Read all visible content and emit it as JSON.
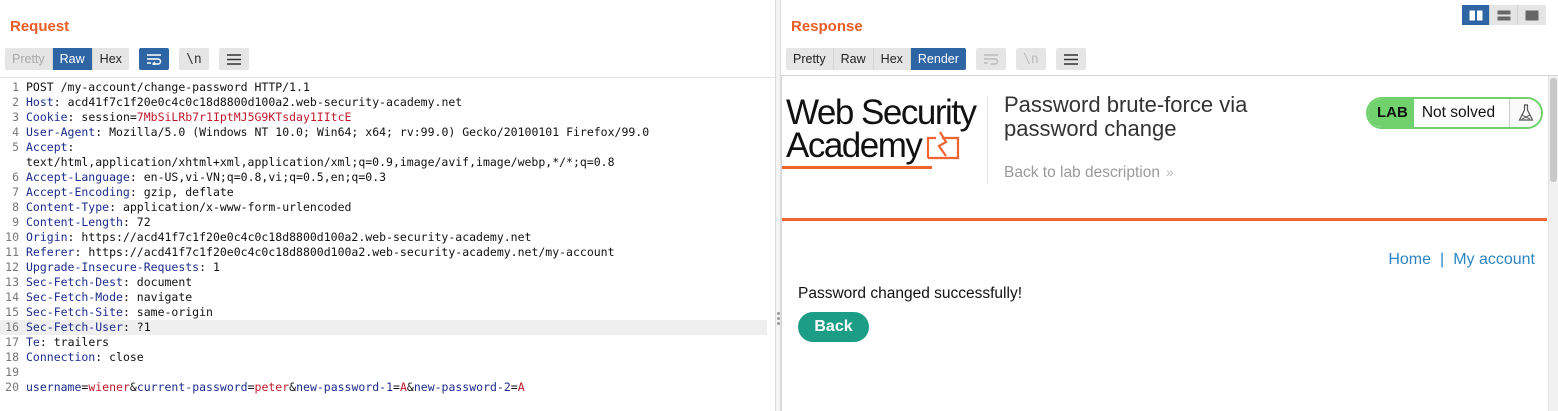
{
  "request": {
    "title": "Request",
    "view_tabs": [
      "Pretty",
      "Raw",
      "Hex"
    ],
    "active_tab": "Raw",
    "newline_label": "\\n",
    "lines": [
      {
        "num": "1",
        "raw": "POST /my-account/change-password HTTP/1.1"
      },
      {
        "num": "2",
        "key": "Host",
        "value": " acd41f7c1f20e0c4c0c18d8800d100a2.web-security-academy.net"
      },
      {
        "num": "3",
        "key": "Cookie",
        "value": " session=",
        "value_red": "7MbSiLRb7r1IptMJ5G9KTsday1IItcE"
      },
      {
        "num": "4",
        "key": "User-Agent",
        "value": " Mozilla/5.0 (Windows NT 10.0; Win64; x64; rv:99.0) Gecko/20100101 Firefox/99.0"
      },
      {
        "num": "5",
        "key": "Accept",
        "value": ""
      },
      {
        "num": "",
        "raw": "text/html,application/xhtml+xml,application/xml;q=0.9,image/avif,image/webp,*/*;q=0.8"
      },
      {
        "num": "6",
        "key": "Accept-Language",
        "value": " en-US,vi-VN;q=0.8,vi;q=0.5,en;q=0.3"
      },
      {
        "num": "7",
        "key": "Accept-Encoding",
        "value": " gzip, deflate"
      },
      {
        "num": "8",
        "key": "Content-Type",
        "value": " application/x-www-form-urlencoded"
      },
      {
        "num": "9",
        "key": "Content-Length",
        "value": " 72"
      },
      {
        "num": "10",
        "key": "Origin",
        "value": " https://acd41f7c1f20e0c4c0c18d8800d100a2.web-security-academy.net"
      },
      {
        "num": "11",
        "key": "Referer",
        "value": " https://acd41f7c1f20e0c4c0c18d8800d100a2.web-security-academy.net/my-account"
      },
      {
        "num": "12",
        "key": "Upgrade-Insecure-Requests",
        "value": " 1"
      },
      {
        "num": "13",
        "key": "Sec-Fetch-Dest",
        "value": " document"
      },
      {
        "num": "14",
        "key": "Sec-Fetch-Mode",
        "value": " navigate"
      },
      {
        "num": "15",
        "key": "Sec-Fetch-Site",
        "value": " same-origin"
      },
      {
        "num": "16",
        "key": "Sec-Fetch-User",
        "value": " ?1",
        "highlight": true
      },
      {
        "num": "17",
        "key": "Te",
        "value": " trailers"
      },
      {
        "num": "18",
        "key": "Connection",
        "value": " close"
      },
      {
        "num": "19",
        "raw": ""
      },
      {
        "num": "20",
        "body": [
          {
            "k": "username"
          },
          {
            "t": "="
          },
          {
            "r": "wiener"
          },
          {
            "t": "&"
          },
          {
            "k": "current-password"
          },
          {
            "t": "="
          },
          {
            "r": "peter"
          },
          {
            "t": "&"
          },
          {
            "k": "new-password-1"
          },
          {
            "t": "="
          },
          {
            "r": "A"
          },
          {
            "t": "&"
          },
          {
            "k": "new-password-2"
          },
          {
            "t": "="
          },
          {
            "r": "A"
          }
        ]
      }
    ]
  },
  "response": {
    "title": "Response",
    "view_tabs": [
      "Pretty",
      "Raw",
      "Hex",
      "Render"
    ],
    "active_tab": "Render",
    "newline_label": "\\n",
    "render": {
      "logo_line1": "Web Security",
      "logo_line2": "Academy",
      "lab_title": "Password brute-force via password change",
      "back_link": "Back to lab description",
      "back_chevron": "»",
      "lab_tag": "LAB",
      "lab_status": "Not solved",
      "nav_home": "Home",
      "nav_separator": "|",
      "nav_account": "My account",
      "message": "Password changed successfully!",
      "back_button": "Back"
    }
  },
  "colors": {
    "accent_orange": "#e85d26",
    "tab_active": "#2e66a5",
    "lab_green": "#70d16d",
    "back_button": "#1c9d85",
    "link_blue": "#2d86c3"
  }
}
